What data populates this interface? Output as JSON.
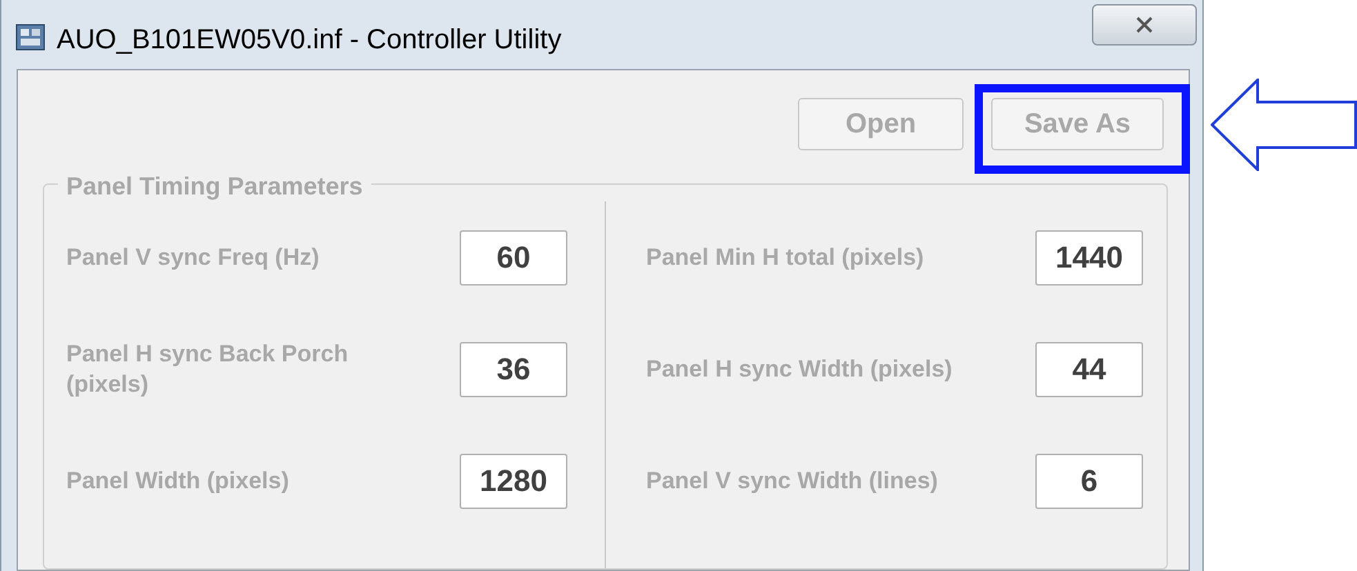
{
  "window": {
    "title": "AUO_B101EW05V0.inf - Controller Utility"
  },
  "buttons": [
    {
      "label": "Open",
      "disabled": true,
      "highlighted": false
    },
    {
      "label": "Save As",
      "disabled": true,
      "highlighted": true
    }
  ],
  "group": {
    "title": "Panel Timing Parameters",
    "disabled": true,
    "columns": [
      [
        {
          "label": "Panel V sync Freq (Hz)",
          "value": "60"
        },
        {
          "label": "Panel H sync Back Porch (pixels)",
          "value": "36"
        },
        {
          "label": "Panel Width (pixels)",
          "value": "1280"
        }
      ],
      [
        {
          "label": "Panel Min H total (pixels)",
          "value": "1440"
        },
        {
          "label": "Panel H sync Width (pixels)",
          "value": "44"
        },
        {
          "label": "Panel V sync Width (lines)",
          "value": "6"
        }
      ]
    ]
  }
}
